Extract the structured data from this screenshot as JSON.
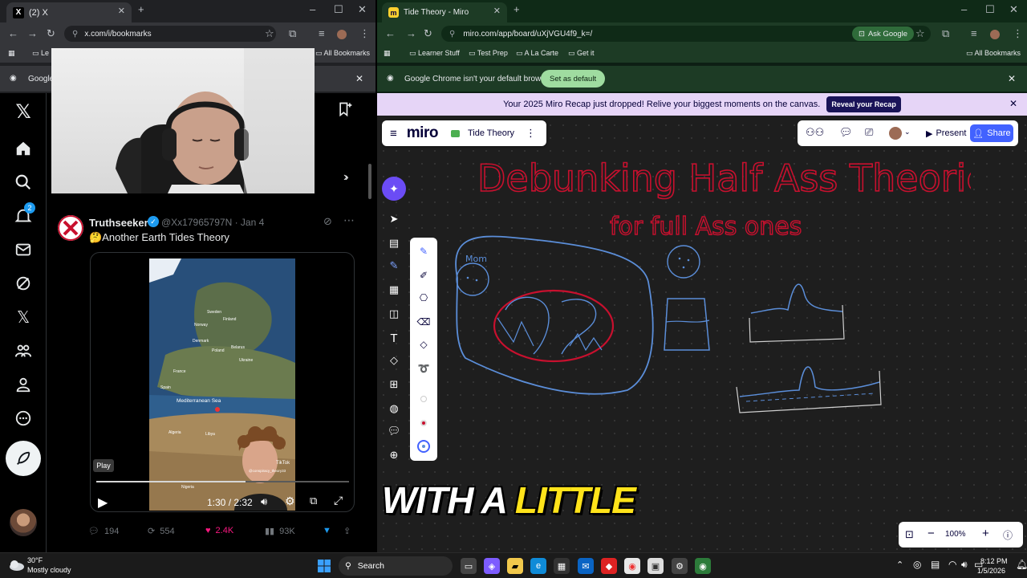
{
  "left_browser": {
    "tab_title": "(2) X",
    "url": "x.com/i/bookmarks",
    "bookmarks_label": "All Bookmarks",
    "bookmark_first": "Le",
    "info_text": "Google"
  },
  "x_nav": {
    "notification_count": "2"
  },
  "tweet": {
    "name": "Truthseeker",
    "handle": "@Xx17965797N · Jan 4",
    "text": "🤔Another Earth Tides Theory",
    "video_labels": {
      "mediterranean": "Mediterranean Sea",
      "sweden": "Sweden",
      "finland": "Finland",
      "norway": "Norway",
      "denmark": "Denmark",
      "poland": "Poland",
      "belarus": "Belarus",
      "ukraine": "Ukraine",
      "france": "France",
      "spain": "Spain",
      "algeria": "Algeria",
      "libya": "Libya",
      "nigeria": "Nigeria",
      "tiktok": "TikTok",
      "tiktok_handle": "@conspiracy_theory33"
    },
    "tooltip": "Play",
    "time": "1:30 / 2:32",
    "progress": 0.59,
    "replies": "194",
    "reposts": "554",
    "likes": "2.4K",
    "views": "93K"
  },
  "right_browser": {
    "tab_title": "Tide Theory - Miro",
    "url": "miro.com/app/board/uXjVGU4f9_k=/",
    "ask_google": "Ask Google",
    "bookmarks": [
      "Learner Stuff",
      "Test Prep",
      "A La Carte",
      "Get it"
    ],
    "all_bookmarks": "All Bookmarks",
    "default_msg": "Google Chrome isn't your default browser",
    "set_default": "Set as default"
  },
  "miro": {
    "recap_text": "Your 2025 Miro Recap just dropped! Relive your biggest moments on the canvas.",
    "recap_button": "Reveal your Recap",
    "logo": "miro",
    "board_name": "Tide Theory",
    "present": "Present",
    "share": "Share",
    "zoom": "100%",
    "sketch_title": "Debunking Half Ass Theories",
    "sketch_subtitle": "for full Ass ones",
    "sketch_mom": "Mom",
    "colors": {
      "ink_red": "#c8102e",
      "ink_blue": "#5b8ed9",
      "accent": "#4262ff"
    }
  },
  "caption": {
    "part1": "WITH A ",
    "part2": "LITTLE"
  },
  "taskbar": {
    "weather_temp": "30°F",
    "weather_desc": "Mostly cloudy",
    "search": "Search",
    "time": "8:12 PM",
    "date": "1/5/2026"
  }
}
